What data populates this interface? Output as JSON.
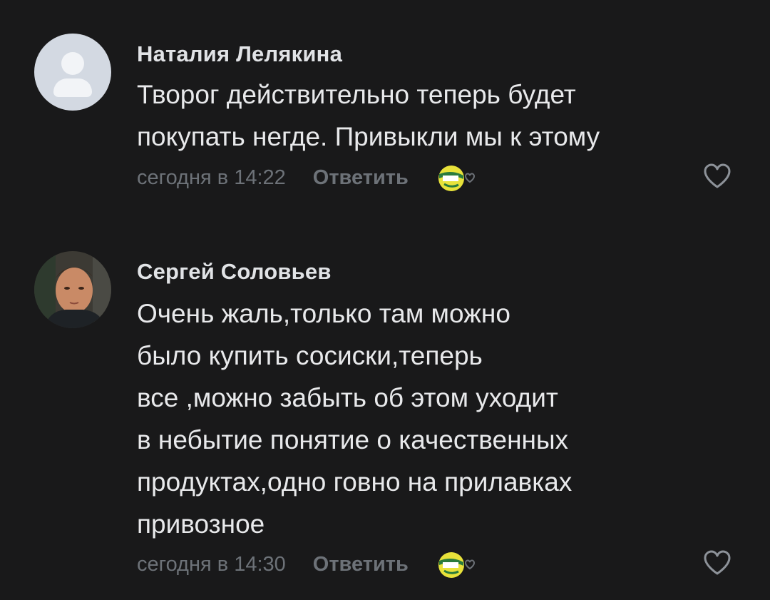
{
  "comments": [
    {
      "author": "Наталия Лелякина",
      "text": "Творог действительно теперь будет\nпокупать негде. Привыкли мы к этому",
      "time": "сегодня в 14:22",
      "reply_label": "Ответить",
      "avatar": "placeholder-user-icon"
    },
    {
      "author": "Сергей Соловьев",
      "text": "Очень жаль,только там можно\nбыло купить сосиски,теперь\nвсе ,можно забыть об этом уходит\nв небытие понятие о качественных\nпродуктах,одно говно на прилавках\nпривозное",
      "time": "сегодня в 14:30",
      "reply_label": "Ответить",
      "avatar": "user-photo"
    }
  ],
  "colors": {
    "background": "#19191a",
    "text": "#e8e9eb",
    "muted": "#6d7278",
    "reaction_yellow": "#e8e23a"
  }
}
